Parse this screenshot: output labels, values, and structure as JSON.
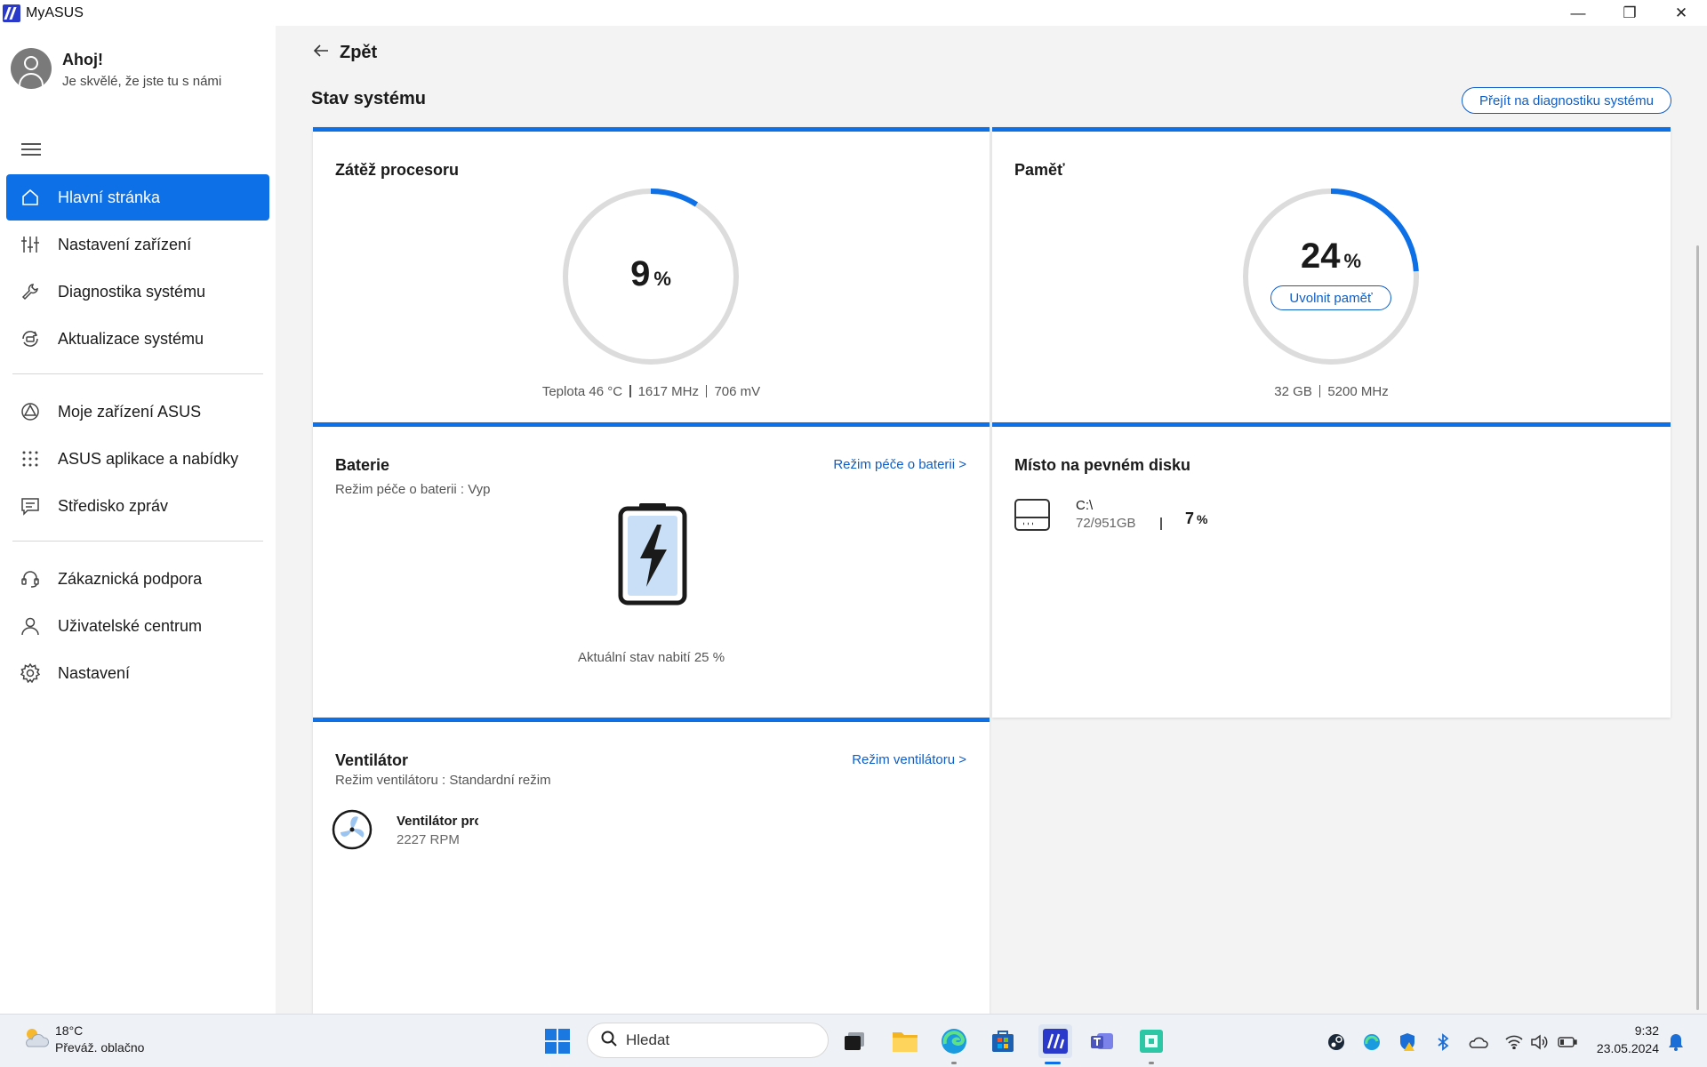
{
  "window": {
    "title": "MyASUS",
    "minimize_glyph": "—",
    "restore_glyph": "❐",
    "close_glyph": "✕"
  },
  "sidebar": {
    "greeting": "Ahoj!",
    "greeting_sub": "Je skvělé, že jste tu s námi",
    "items": [
      {
        "label": "Hlavní stránka",
        "icon": "home-icon",
        "active": true
      },
      {
        "label": "Nastavení zařízení",
        "icon": "sliders-icon"
      },
      {
        "label": "Diagnostika systému",
        "icon": "wrench-icon"
      },
      {
        "label": "Aktualizace systému",
        "icon": "update-icon"
      },
      {
        "label": "Moje zařízení ASUS",
        "icon": "device-icon"
      },
      {
        "label": "ASUS aplikace a nabídky",
        "icon": "apps-grid-icon"
      },
      {
        "label": "Středisko zpráv",
        "icon": "message-icon"
      },
      {
        "label": "Zákaznická podpora",
        "icon": "headset-icon"
      },
      {
        "label": "Uživatelské centrum",
        "icon": "user-icon"
      },
      {
        "label": "Nastavení",
        "icon": "gear-icon"
      }
    ]
  },
  "main": {
    "back_label": "Zpět",
    "title": "Stav systému",
    "diag_button": "Přejít na diagnostiku systému",
    "cpu": {
      "title": "Zátěž procesoru",
      "value": "9",
      "unit": "%",
      "load_fraction": 0.09,
      "temp": "Teplota 46 °C",
      "freq": "1617 MHz",
      "voltage": "706 mV"
    },
    "memory": {
      "title": "Paměť",
      "value": "24",
      "unit": "%",
      "load_fraction": 0.24,
      "free_button": "Uvolnit paměť",
      "size": "32 GB",
      "freq": "5200 MHz"
    },
    "battery": {
      "title": "Baterie",
      "link": "Režim péče o baterii  >",
      "mode": "Režim péče o baterii   : Vyp",
      "charge_text": "Aktuální stav nabití 25 %",
      "charge_fraction": 0.25
    },
    "disk": {
      "title": "Místo na pevném disku",
      "drive": "C:\\",
      "usage": "72/951GB",
      "percent": "7",
      "unit": "%"
    },
    "fan": {
      "title": "Ventilátor",
      "link": "Režim ventilátoru >",
      "mode": "Režim ventilátoru : Standardní režim",
      "name": "Ventilátor prc",
      "rpm": "2227 RPM"
    }
  },
  "taskbar": {
    "weather_temp": "18°C",
    "weather_desc": "Převáž. oblačno",
    "search_placeholder": "Hledat",
    "time": "9:32",
    "date": "23.05.2024"
  },
  "colors": {
    "accent": "#0e70e6",
    "ring_track": "#dcdcdc",
    "link": "#0e5ec9"
  }
}
